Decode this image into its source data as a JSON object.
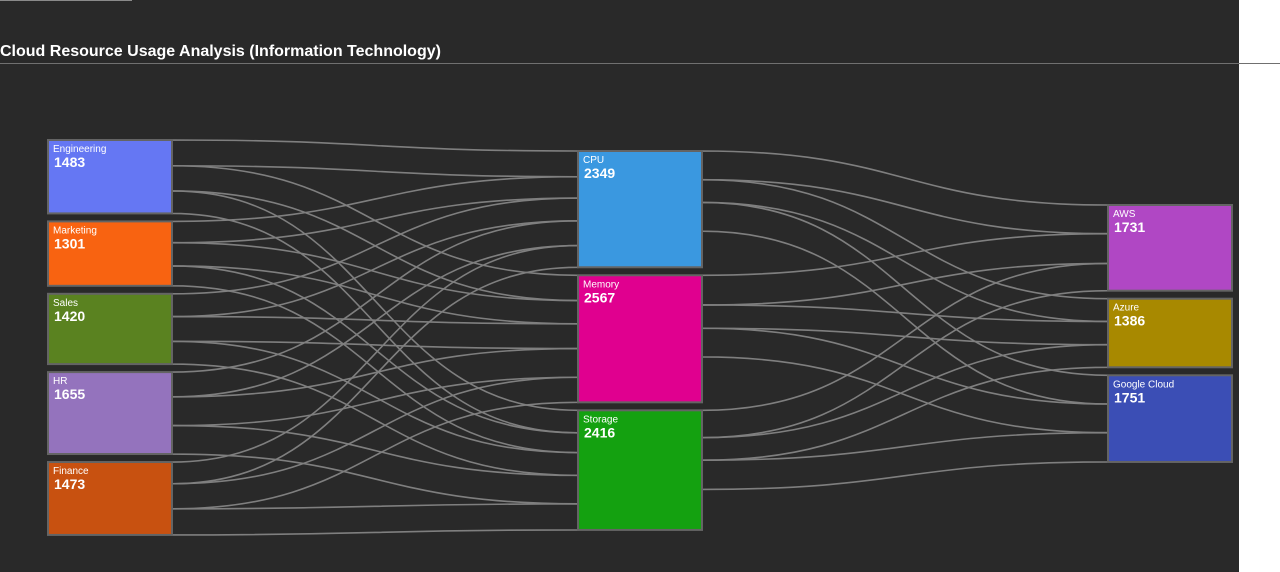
{
  "page": {
    "title": "Cloud Resource Usage Analysis (Information Technology)"
  },
  "chart_data": {
    "type": "sankey",
    "title": "Cloud Resource Usage Analysis (Information Technology)",
    "link_color": "#7f7f7f",
    "node_border_color": "#646464",
    "nodes": [
      {
        "name": "Engineering",
        "value": 1483,
        "color": "#6577f3",
        "column": 0
      },
      {
        "name": "Marketing",
        "value": 1301,
        "color": "#f86311",
        "column": 0
      },
      {
        "name": "Sales",
        "value": 1420,
        "color": "#5a8220",
        "column": 0
      },
      {
        "name": "HR",
        "value": 1655,
        "color": "#9473bd",
        "column": 0
      },
      {
        "name": "Finance",
        "value": 1473,
        "color": "#c85110",
        "column": 0
      },
      {
        "name": "CPU",
        "value": 2349,
        "color": "#3a98e0",
        "column": 1
      },
      {
        "name": "Memory",
        "value": 2567,
        "color": "#e0008f",
        "column": 1
      },
      {
        "name": "Storage",
        "value": 2416,
        "color": "#14a110",
        "column": 1
      },
      {
        "name": "AWS",
        "value": 1731,
        "color": "#b047c4",
        "column": 2
      },
      {
        "name": "Azure",
        "value": 1386,
        "color": "#a88900",
        "column": 2
      },
      {
        "name": "Google Cloud",
        "value": 1751,
        "color": "#3b4eb5",
        "column": 2
      }
    ],
    "links": [
      {
        "source": "Engineering",
        "target": "CPU",
        "value": 520
      },
      {
        "source": "Engineering",
        "target": "Memory",
        "value": 510
      },
      {
        "source": "Engineering",
        "target": "Storage",
        "value": 453
      },
      {
        "source": "Marketing",
        "target": "CPU",
        "value": 430
      },
      {
        "source": "Marketing",
        "target": "Memory",
        "value": 470
      },
      {
        "source": "Marketing",
        "target": "Storage",
        "value": 401
      },
      {
        "source": "Sales",
        "target": "CPU",
        "value": 460
      },
      {
        "source": "Sales",
        "target": "Memory",
        "value": 500
      },
      {
        "source": "Sales",
        "target": "Storage",
        "value": 460
      },
      {
        "source": "HR",
        "target": "CPU",
        "value": 500
      },
      {
        "source": "HR",
        "target": "Memory",
        "value": 580
      },
      {
        "source": "HR",
        "target": "Storage",
        "value": 575
      },
      {
        "source": "Finance",
        "target": "CPU",
        "value": 439
      },
      {
        "source": "Finance",
        "target": "Memory",
        "value": 507
      },
      {
        "source": "Finance",
        "target": "Storage",
        "value": 527
      },
      {
        "source": "CPU",
        "target": "AWS",
        "value": 580
      },
      {
        "source": "CPU",
        "target": "Azure",
        "value": 460
      },
      {
        "source": "CPU",
        "target": "Google Cloud",
        "value": 580
      },
      {
        "source": "Memory",
        "target": "AWS",
        "value": 600
      },
      {
        "source": "Memory",
        "target": "Azure",
        "value": 470
      },
      {
        "source": "Memory",
        "target": "Google Cloud",
        "value": 580
      },
      {
        "source": "Storage",
        "target": "AWS",
        "value": 551
      },
      {
        "source": "Storage",
        "target": "Azure",
        "value": 456
      },
      {
        "source": "Storage",
        "target": "Google Cloud",
        "value": 591
      }
    ]
  }
}
